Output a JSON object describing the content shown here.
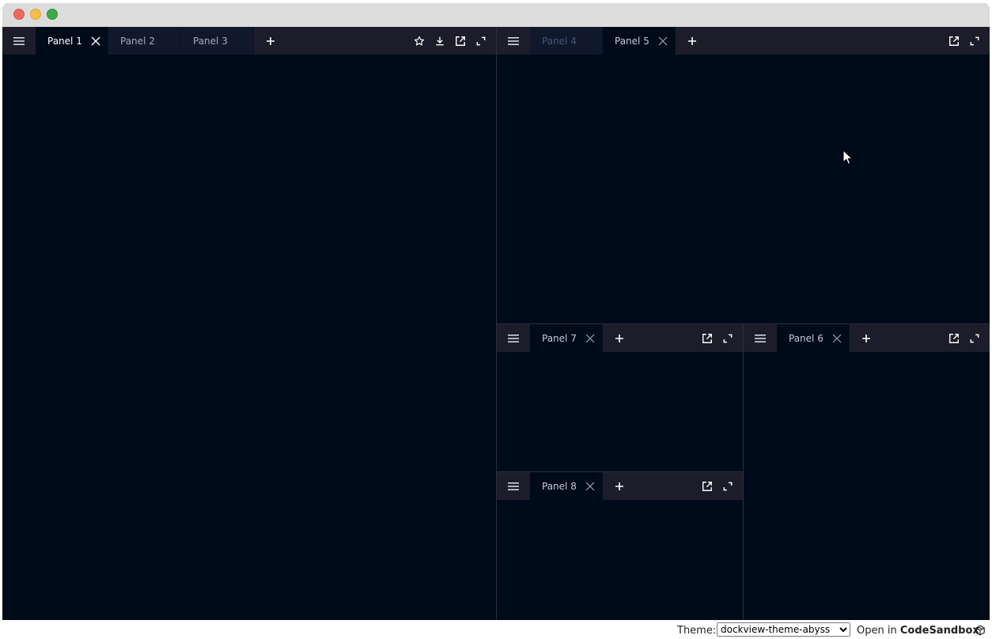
{
  "window": {
    "traffic_lights": [
      "close",
      "minimize",
      "zoom"
    ]
  },
  "groups": {
    "left": {
      "tabs": [
        {
          "label": "Panel 1",
          "active": true,
          "closable": true
        },
        {
          "label": "Panel 2",
          "active": false,
          "closable": false
        },
        {
          "label": "Panel 3",
          "active": false,
          "closable": false
        }
      ],
      "actions": [
        "star-icon",
        "download-icon",
        "popout-icon",
        "maximize-icon"
      ]
    },
    "top_right": {
      "tabs": [
        {
          "label": "Panel 4",
          "active": false,
          "closable": false
        },
        {
          "label": "Panel 5",
          "active": true,
          "closable": true
        }
      ],
      "actions": [
        "popout-icon",
        "maximize-icon"
      ]
    },
    "mid_a": {
      "tabs": [
        {
          "label": "Panel 7",
          "active": true,
          "closable": true
        }
      ],
      "actions": [
        "popout-icon",
        "maximize-icon"
      ]
    },
    "mid_b": {
      "tabs": [
        {
          "label": "Panel 6",
          "active": true,
          "closable": true
        }
      ],
      "actions": [
        "popout-icon",
        "maximize-icon"
      ]
    },
    "bottom_a": {
      "tabs": [
        {
          "label": "Panel 8",
          "active": true,
          "closable": true
        }
      ],
      "actions": [
        "popout-icon",
        "maximize-icon"
      ]
    }
  },
  "footer": {
    "theme_label": "Theme:",
    "theme_value": "dockview-theme-abyss",
    "open_prefix": "Open in ",
    "open_brand": "CodeSandbox"
  },
  "colors": {
    "background": "#000b19",
    "header": "#1c1c2a",
    "inactive_tab": "#10192c"
  }
}
